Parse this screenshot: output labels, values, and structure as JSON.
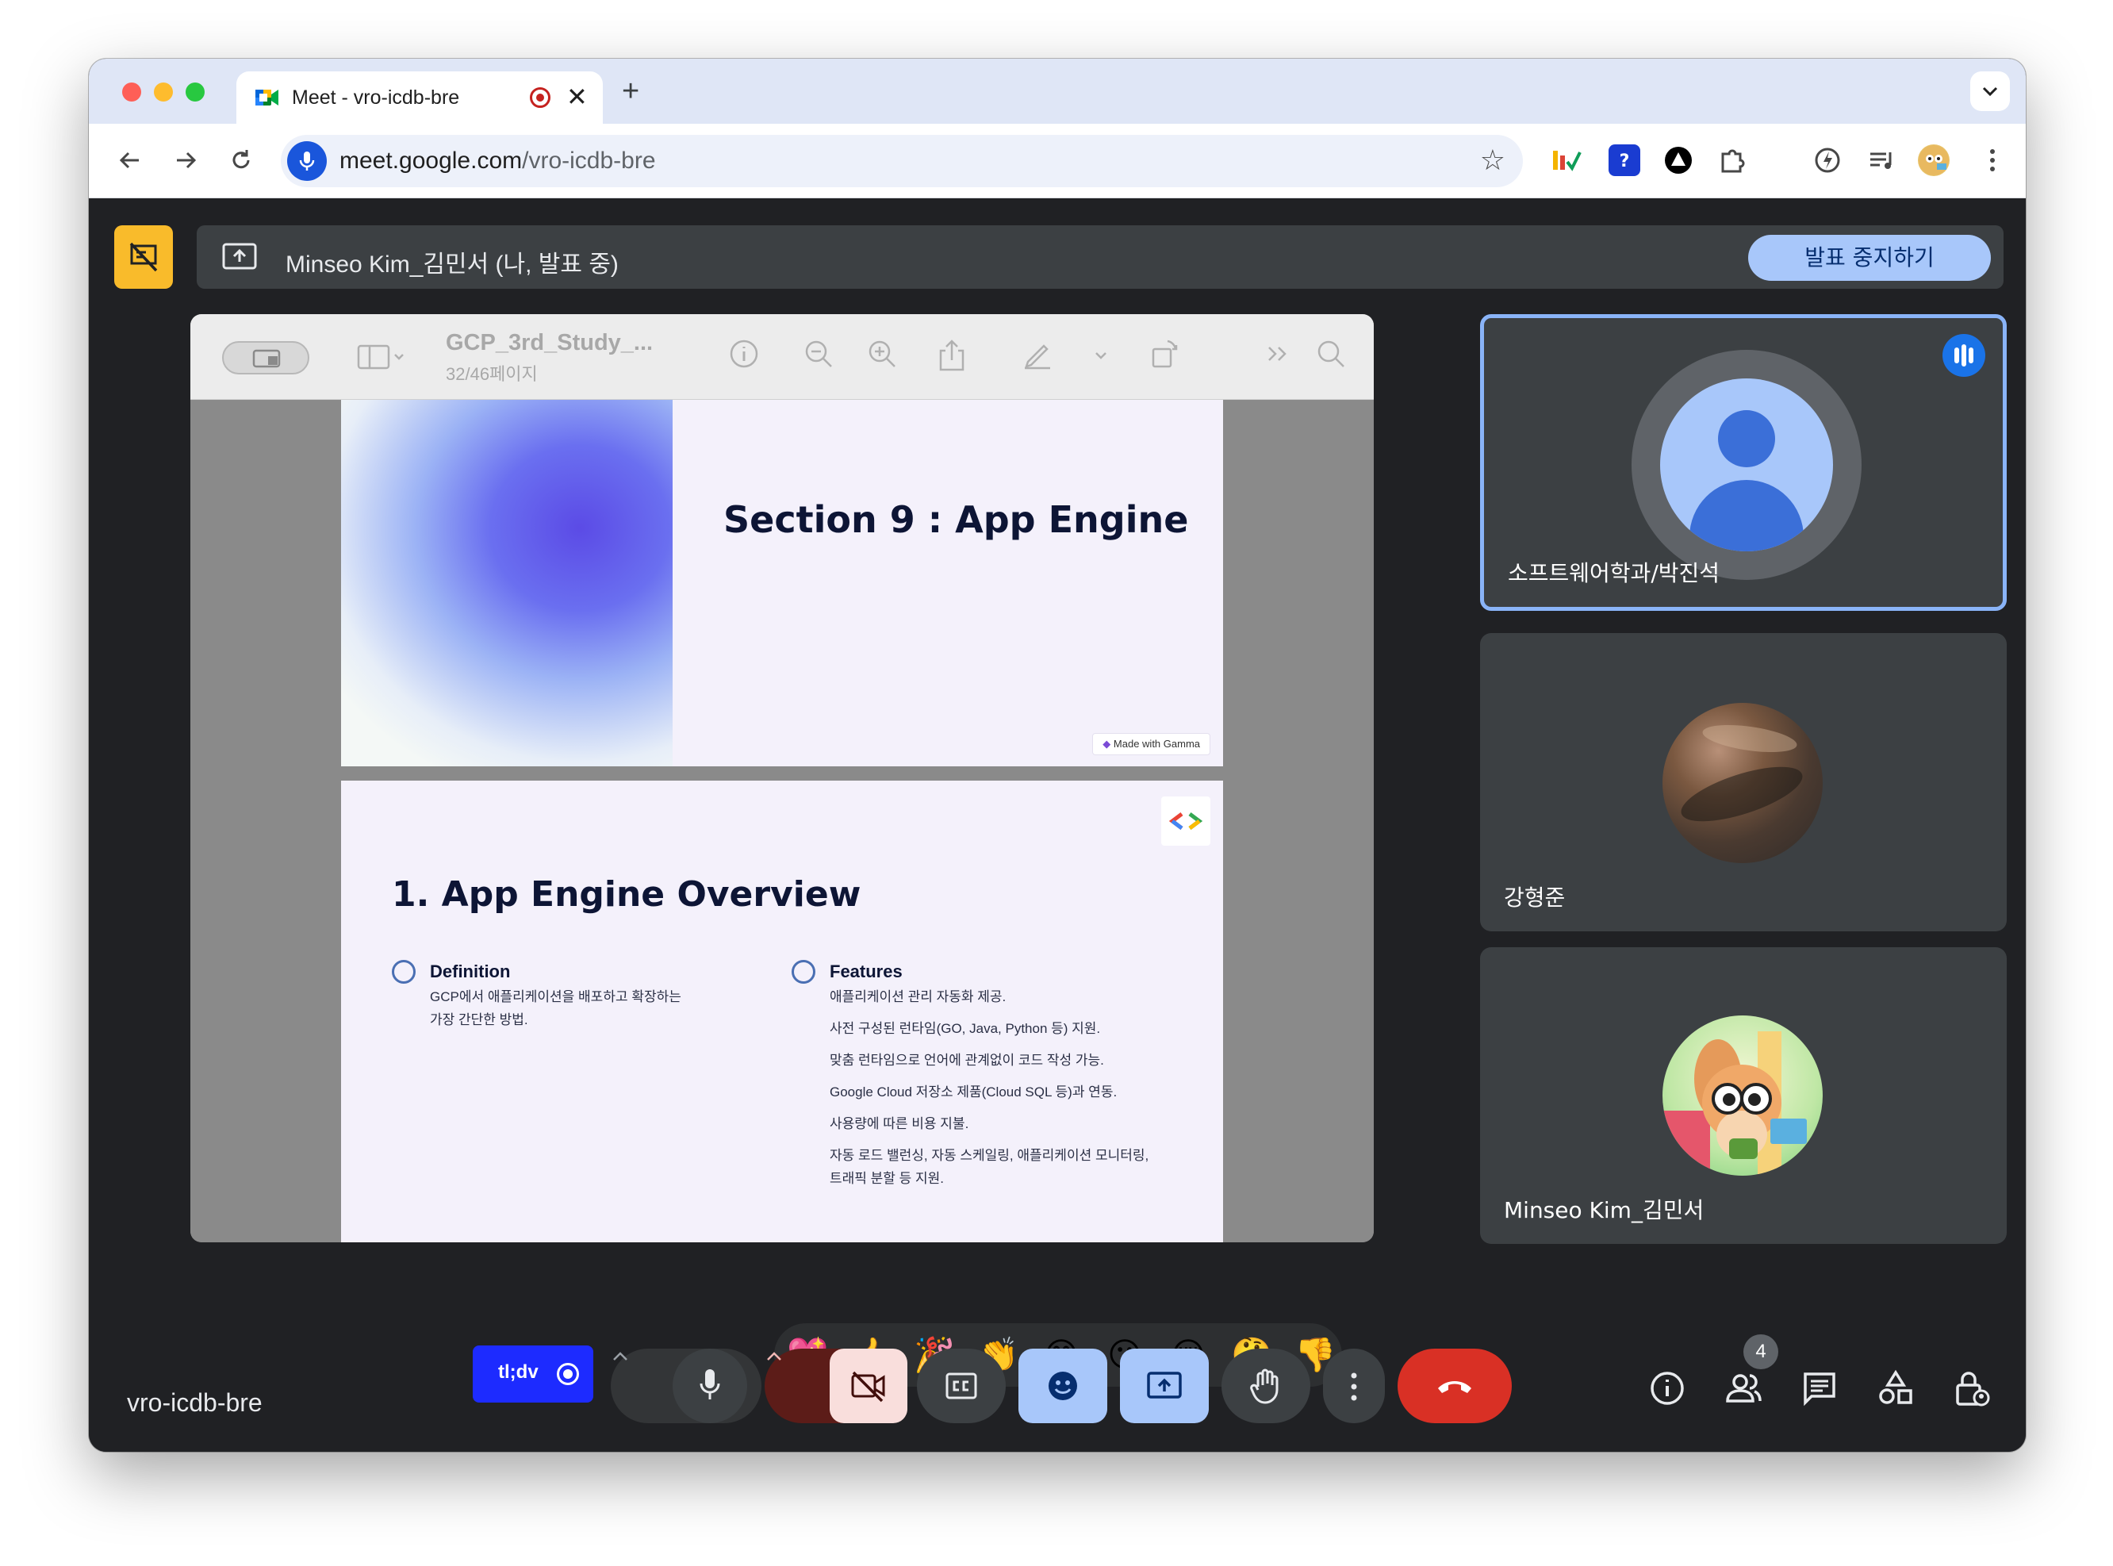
{
  "browser": {
    "tab_title": "Meet - vro-icdb-bre",
    "url_host": "meet.google.com",
    "url_path": "/vro-icdb-bre",
    "new_tab_label": "+",
    "close_tab_label": "✕"
  },
  "meet": {
    "presenting_banner": "Minseo Kim_김민서 (나, 발표 중)",
    "stop_presenting_label": "발표 중지하기",
    "meeting_code": "vro-icdb-bre",
    "tldv_label": "tl;dv",
    "people_count": "4"
  },
  "viewer": {
    "doc_title": "GCP_3rd_Study_...",
    "page_indicator": "32/46페이지"
  },
  "slides": {
    "slide1_title": "Section 9 : App Engine",
    "gamma_badge": "Made with Gamma",
    "slide2_title": "1. App Engine Overview",
    "definition_head": "Definition",
    "definition_lines": [
      "GCP에서 애플리케이션을 배포하고 확장하는",
      "가장 간단한 방법."
    ],
    "features_head": "Features",
    "features_lines": [
      "애플리케이션 관리 자동화 제공.",
      "사전 구성된 런타임(GO, Java, Python 등) 지원.",
      "맞춤 런타임으로 언어에 관계없이 코드 작성 가능.",
      "Google Cloud 저장소 제품(Cloud SQL 등)과 연동.",
      "사용량에 따른 비용 지불.",
      "자동 로드 밸런싱, 자동 스케일링, 애플리케이션 모니터링,",
      "트래픽 분할 등 지원."
    ]
  },
  "participants": [
    {
      "name": "소프트웨어학과/박진석",
      "speaking": true
    },
    {
      "name": "강형준"
    },
    {
      "name": "Minseo Kim_김민서"
    }
  ],
  "reactions": [
    "💖",
    "👍",
    "🎉",
    "👏",
    "😂",
    "😮",
    "😢",
    "🤔",
    "👎"
  ],
  "colors": {
    "meet_bg": "#202124",
    "tile_bg": "#3c4043",
    "stop_button": "#a8c7fa",
    "hangup": "#d93025",
    "tldv": "#1d2bff",
    "warn_badge": "#f9bb2b"
  }
}
